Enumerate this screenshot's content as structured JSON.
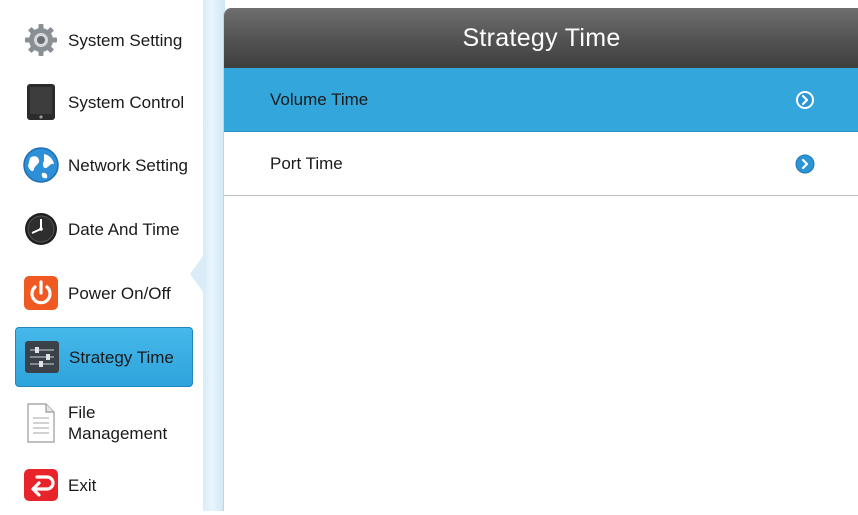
{
  "sidebar": {
    "items": [
      {
        "label": "System Setting",
        "icon": "gear-icon",
        "active": false
      },
      {
        "label": "System Control",
        "icon": "tablet-icon",
        "active": false
      },
      {
        "label": "Network Setting",
        "icon": "globe-icon",
        "active": false
      },
      {
        "label": "Date And Time",
        "icon": "clock-icon",
        "active": false
      },
      {
        "label": "Power On/Off",
        "icon": "power-icon",
        "active": false
      },
      {
        "label": "Strategy Time",
        "icon": "sliders-icon",
        "active": true
      },
      {
        "label": "File Management",
        "icon": "document-icon",
        "active": false
      },
      {
        "label": "Exit",
        "icon": "exit-icon",
        "active": false
      }
    ]
  },
  "main": {
    "title": "Strategy Time",
    "options": [
      {
        "label": "Volume Time",
        "selected": true,
        "icon": "chevron-right-circle-icon"
      },
      {
        "label": "Port Time",
        "selected": false,
        "icon": "chevron-right-circle-icon"
      }
    ]
  },
  "colors": {
    "accent": "#33a6dc",
    "title_bar": "#545454",
    "exit": "#e8242a",
    "power": "#f05a22"
  }
}
